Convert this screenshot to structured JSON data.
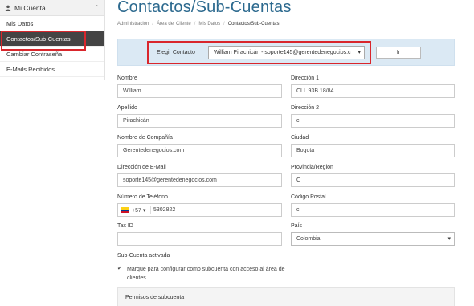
{
  "sidebar": {
    "header": "Mi Cuenta",
    "items": [
      {
        "label": "Mis Datos"
      },
      {
        "label": "Contactos/Sub-Cuentas"
      },
      {
        "label": "Cambiar Contraseña"
      },
      {
        "label": "E-Mails Recibidos"
      }
    ]
  },
  "page": {
    "title": "Contactos/Sub-Cuentas",
    "breadcrumb": [
      "Administración",
      "Área del Cliente",
      "Mis Datos",
      "Contactos/Sub-Cuentas"
    ]
  },
  "chooser": {
    "label": "Elegir Contacto",
    "selected": "William Pirachicán - soporte145@gerentedenegocios.c",
    "button": "Ir"
  },
  "form": {
    "nombre": {
      "label": "Nombre",
      "value": "William"
    },
    "apellido": {
      "label": "Apellido",
      "value": "Pirachicán"
    },
    "compania": {
      "label": "Nombre de Compañía",
      "value": "Gerentedenegocios.com"
    },
    "email": {
      "label": "Dirección de E-Mail",
      "value": "soporte145@gerentedenegocios.com"
    },
    "telefono": {
      "label": "Número de Teléfono",
      "code": "+57",
      "value": "5302822"
    },
    "taxid": {
      "label": "Tax ID",
      "value": ""
    },
    "direccion1": {
      "label": "Dirección 1",
      "value": "CLL 93B 18/84"
    },
    "direccion2": {
      "label": "Dirección 2",
      "value": "c"
    },
    "ciudad": {
      "label": "Ciudad",
      "value": "Bogota"
    },
    "provincia": {
      "label": "Provincia/Región",
      "value": "C"
    },
    "postal": {
      "label": "Código Postal",
      "value": "c"
    },
    "pais": {
      "label": "País",
      "value": "Colombia"
    },
    "subcuenta": {
      "label": "Sub-Cuenta activada",
      "checkbox_text": "Marque para configurar como subcuenta con acceso al área de clientes",
      "checked": true
    },
    "permisos": {
      "label": "Permisos de subcuenta"
    }
  },
  "colors": {
    "accent": "#2d6a8f",
    "highlight": "#d9262c",
    "active_bg": "#444444",
    "chooser_bg": "#dbe9f4"
  }
}
